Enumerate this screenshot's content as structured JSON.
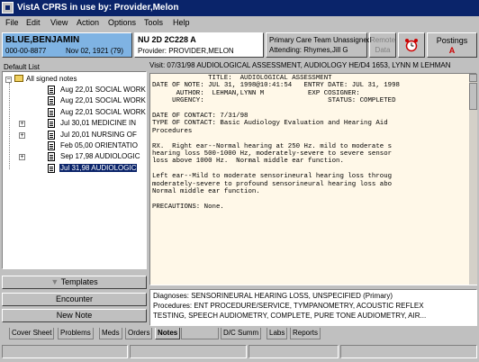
{
  "window": {
    "title": "VistA CPRS in use by: Provider,Melon"
  },
  "menu": [
    "File",
    "Edit",
    "View",
    "Action",
    "Options",
    "Tools",
    "Help"
  ],
  "patient": {
    "name": "BLUE,BENJAMIN",
    "ssn": "000-00-8877",
    "dob": "Nov 02, 1921 (79)"
  },
  "location": {
    "ward": "NU 2D 2C228 A",
    "provider": "Provider: PROVIDER,MELON"
  },
  "primary_care": {
    "team": "Primary Care Team Unassigned",
    "attending": "Attending: Rhymes,Jill G"
  },
  "toolbar": {
    "remote_line1": "Remote",
    "remote_line2": "Data",
    "postings_label": "Postings",
    "postings_flag": "A"
  },
  "notes_list": {
    "title": "Default List",
    "root": "All signed notes",
    "items": [
      {
        "label": "Aug 22,01  SOCIAL WORK",
        "expander": ""
      },
      {
        "label": "Aug 22,01  SOCIAL WORK",
        "expander": ""
      },
      {
        "label": "Aug 22,01  SOCIAL WORK",
        "expander": ""
      },
      {
        "label": "Jul 30,01  MEDICINE IN",
        "expander": "+"
      },
      {
        "label": "Jul 20,01  NURSING OF",
        "expander": "+"
      },
      {
        "label": "Feb 05,00  ORIENTATIO",
        "expander": ""
      },
      {
        "label": "Sep 17,98  AUDIOLOGIC",
        "expander": "+"
      },
      {
        "label": "Jul 31,98  AUDIOLOGIC",
        "expander": ""
      }
    ],
    "selected_index": 7
  },
  "buttons": {
    "templates": "Templates",
    "encounter": "Encounter",
    "new_note": "New Note"
  },
  "visit": {
    "header": "Visit: 07/31/98  AUDIOLOGICAL ASSESSMENT, AUDIOLOGY HE/D4 1653, LYNN M LEHMAN"
  },
  "note": {
    "lines": [
      "              TITLE:  AUDIOLOGICAL ASSESSMENT",
      "DATE OF NOTE: JUL 31, 1998@10:41:54   ENTRY DATE: JUL 31, 1998",
      "      AUTHOR:  LEHMAN,LYNN M           EXP COSIGNER:",
      "     URGENCY:                               STATUS: COMPLETED",
      "",
      "DATE OF CONTACT: 7/31/98",
      "TYPE OF CONTACT: Basic Audiology Evaluation and Hearing Aid",
      "Procedures",
      "",
      "RX.  Right ear--Normal hearing at 250 Hz. mild to moderate s",
      "hearing loss 500-1000 Hz, moderately-severe to severe sensor",
      "loss above 1000 Hz.  Normal middle ear function.",
      "",
      "Left ear--Mild to moderate sensorineural hearing loss throug",
      "moderately-severe to profound sensorineural hearing loss abo",
      "Normal middle ear function.",
      "",
      "PRECAUTIONS: None.",
      "",
      "",
      "",
      "",
      "",
      "",
      "",
      "",
      ""
    ]
  },
  "diagnoses": {
    "dx": "Diagnoses: SENSORINEURAL HEARING LOSS, UNSPECIFIED (Primary)",
    "procedures_1": "Procedures: ENT PROCEDURE/SERVICE, TYMPANOMETRY, ACOUSTIC REFLEX",
    "procedures_2": "TESTING, SPEECH AUDIOMETRY, COMPLETE, PURE TONE AUDIOMETRY, AIR..."
  },
  "tabs": [
    "Cover Sheet",
    "Problems",
    "Meds",
    "Orders",
    "Notes",
    "",
    "D/C Summ",
    "Labs",
    "Reports"
  ],
  "colors": {
    "title_bg": "#0a246a",
    "patient_bg": "#7fb3e3",
    "note_bg": "#fff8e8",
    "selected_bg": "#0a246a",
    "postings_flag": "#cc0000"
  }
}
